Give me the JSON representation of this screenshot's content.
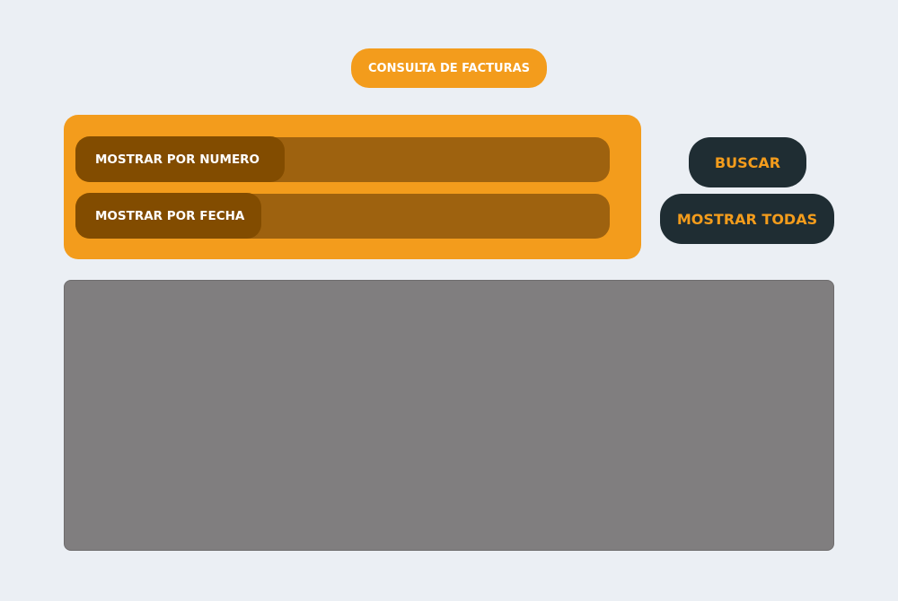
{
  "header": {
    "title": "CONSULTA DE FACTURAS"
  },
  "filters": {
    "by_number": {
      "label": "MOSTRAR POR NUMERO",
      "value": ""
    },
    "by_date": {
      "label": "MOSTRAR POR FECHA",
      "value": ""
    }
  },
  "actions": {
    "search_label": "BUSCAR",
    "show_all_label": "MOSTRAR TODAS"
  },
  "colors": {
    "background": "#ebeff4",
    "accent": "#f39c1c",
    "field": "#9e620f",
    "field_label": "#824c00",
    "button_dark": "#1f2d33",
    "results": "#807e7f"
  }
}
